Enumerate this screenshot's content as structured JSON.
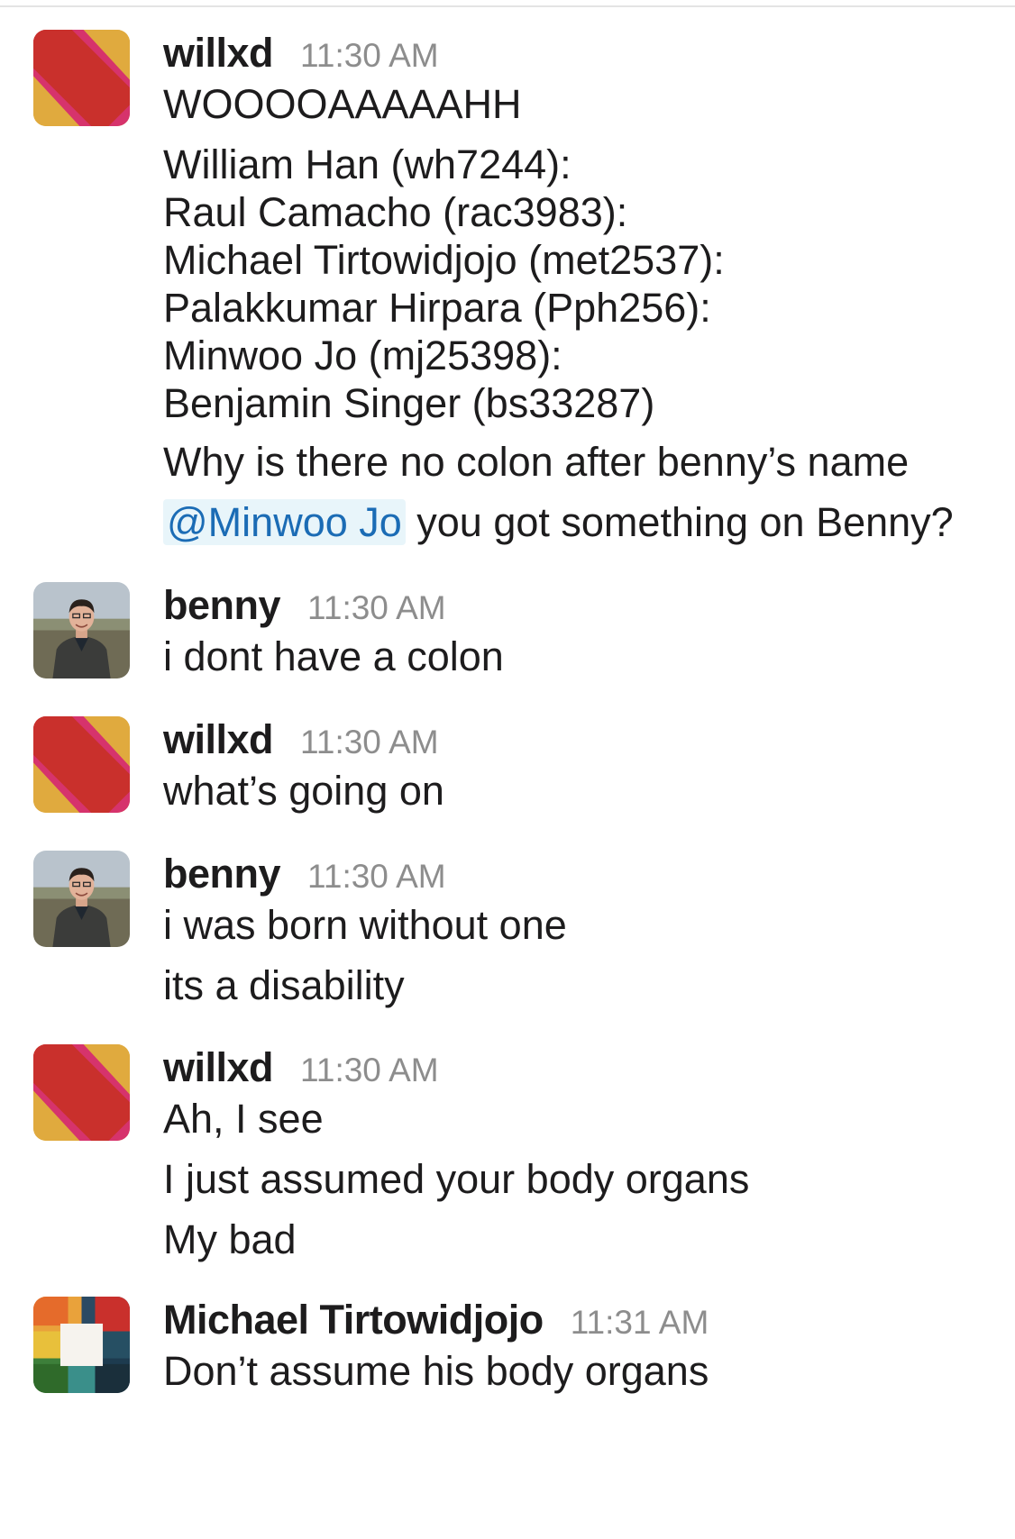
{
  "messages": [
    {
      "author": "willxd",
      "time": "11:30 AM",
      "avatar": "willxd-avatar",
      "lines": [
        "WOOOOAAAAAHH"
      ],
      "list": [
        "William Han (wh7244):",
        "Raul Camacho (rac3983):",
        "Michael Tirtowidjojo (met2537):",
        "Palakkumar Hirpara (Pph256):",
        "Minwoo Jo (mj25398):",
        "Benjamin Singer (bs33287)"
      ],
      "after": [
        "Why is there no colon after benny’s name"
      ],
      "mention": "@Minwoo Jo",
      "mention_text": " you got something on Benny?"
    },
    {
      "author": "benny",
      "time": "11:30 AM",
      "avatar": "benny-photo-avatar",
      "lines": [
        "i dont have a colon"
      ]
    },
    {
      "author": "willxd",
      "time": "11:30 AM",
      "avatar": "willxd-avatar",
      "lines": [
        "what’s going on"
      ]
    },
    {
      "author": "benny",
      "time": "11:30 AM",
      "avatar": "benny-photo-avatar",
      "lines": [
        "i was born without one",
        "its a disability"
      ]
    },
    {
      "author": "willxd",
      "time": "11:30 AM",
      "avatar": "willxd-avatar",
      "lines": [
        "Ah, I see",
        "I just assumed your body organs",
        "My bad"
      ]
    },
    {
      "author": "Michael Tirtowidjojo",
      "time": "11:31 AM",
      "avatar": "michael-avatar",
      "lines": [
        "Don’t assume his body organs"
      ]
    }
  ],
  "colors": {
    "mention_text": "#1b6cb5",
    "mention_bg": "#e8f5fa",
    "timestamp": "#8d8d8d"
  }
}
